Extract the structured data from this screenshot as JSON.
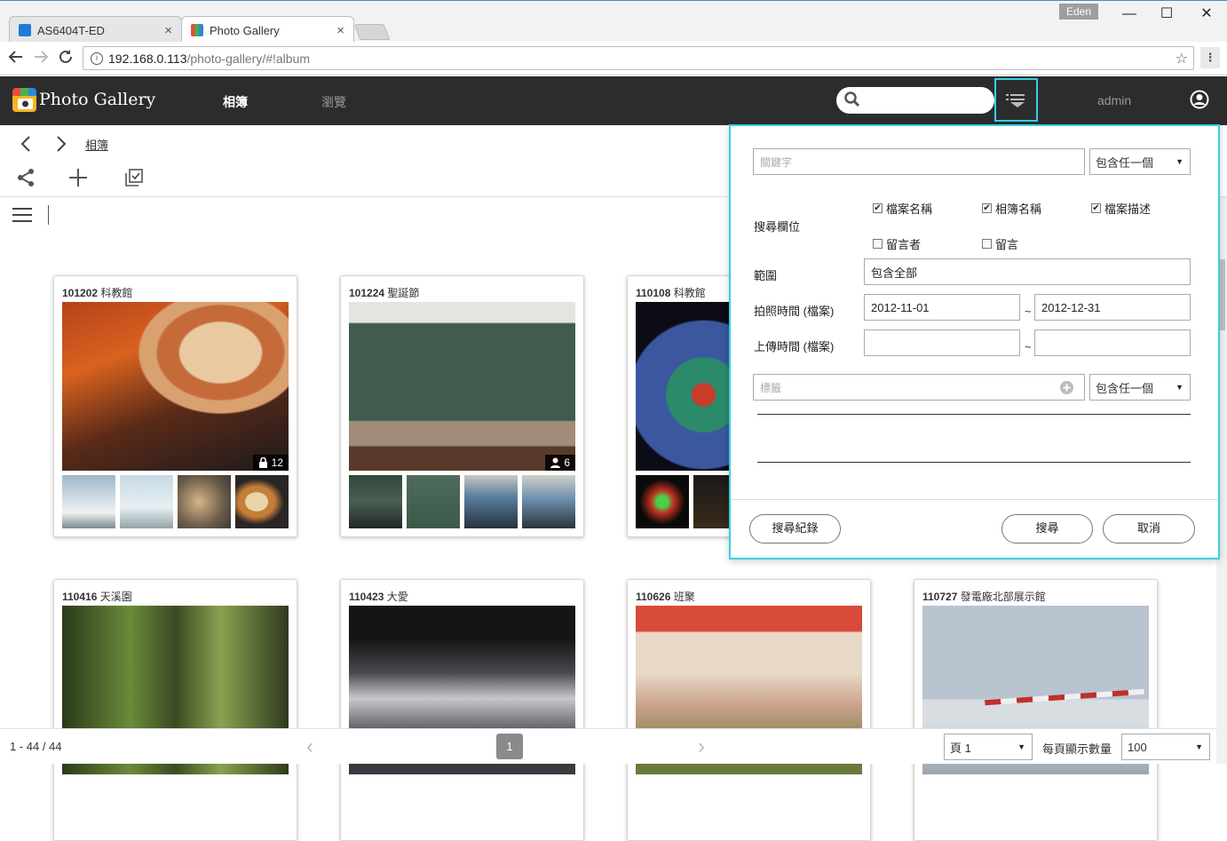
{
  "browser": {
    "tabs": [
      {
        "title": "AS6404T-ED",
        "close": "×"
      },
      {
        "title": "Photo Gallery",
        "close": "×"
      }
    ],
    "profile": "Eden",
    "url_host": "192.168.0.113",
    "url_path": "/photo-gallery/#!album",
    "window": {
      "min": "—",
      "max": "☐",
      "close": "✕"
    },
    "menu": "⋮"
  },
  "app": {
    "title": "Photo Gallery",
    "nav": [
      {
        "label": "相簿"
      },
      {
        "label": "瀏覽"
      }
    ],
    "user": "admin",
    "search_placeholder": ""
  },
  "breadcrumb": {
    "label": "相簿"
  },
  "albums": [
    {
      "title_id": "101202",
      "title_name": "科教館",
      "count": "12",
      "badge_icon": "lock-icon"
    },
    {
      "title_id": "101224",
      "title_name": "聖誕節",
      "count": "6",
      "badge_icon": "person-icon"
    },
    {
      "title_id": "110108",
      "title_name": "科教館",
      "count": "",
      "badge_icon": ""
    },
    {
      "title_id": "110416",
      "title_name": "天溪園"
    },
    {
      "title_id": "110423",
      "title_name": "大愛"
    },
    {
      "title_id": "110626",
      "title_name": "班聚"
    },
    {
      "title_id": "110727",
      "title_name": "發電廠北部展示館"
    }
  ],
  "footer": {
    "range": "1 - 44 / 44",
    "current_page": "1",
    "page_select": "頁 1",
    "per_page_label": "每頁顯示數量",
    "per_page": "100"
  },
  "search_panel": {
    "keyword_placeholder": "關鍵字",
    "keyword_match": "包含任一個",
    "fields_label": "搜尋欄位",
    "fields": [
      {
        "label": "檔案名稱",
        "checked": true
      },
      {
        "label": "相簿名稱",
        "checked": true
      },
      {
        "label": "檔案描述",
        "checked": true
      },
      {
        "label": "留言者",
        "checked": false
      },
      {
        "label": "留言",
        "checked": false
      }
    ],
    "scope_label": "範圍",
    "scope_value": "包含全部",
    "shot_label": "拍照時間 (檔案)",
    "shot_from": "2012-11-01",
    "shot_to": "2012-12-31",
    "upload_label": "上傳時間 (檔案)",
    "upload_from": "",
    "upload_to": "",
    "tilde": "~",
    "tag_placeholder": "標籤",
    "tag_match": "包含任一個",
    "history_button": "搜尋紀錄",
    "search_button": "搜尋",
    "cancel_button": "取消"
  },
  "colors": {
    "appbar": "#2c2c2c",
    "accent": "#38d0e0"
  }
}
